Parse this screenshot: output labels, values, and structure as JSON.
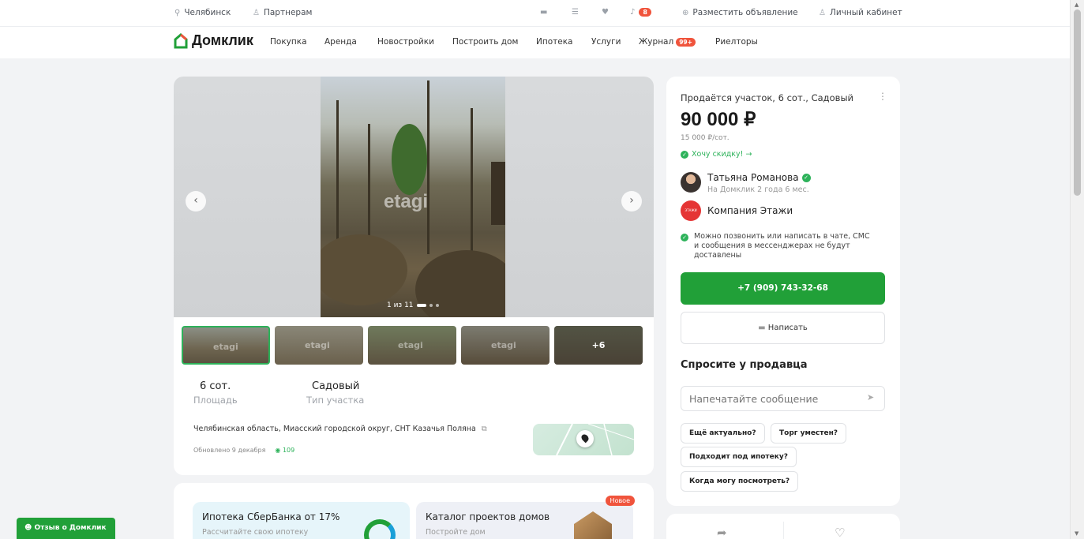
{
  "topbar": {
    "city": "Челябинск",
    "partners": "Партнерам",
    "notifications_count": "8",
    "post_ad": "Разместить объявление",
    "account": "Личный кабинет"
  },
  "nav": {
    "logo": "Домклик",
    "items": [
      "Покупка",
      "Аренда",
      "Новостройки",
      "Построить дом",
      "Ипотека",
      "Услуги",
      "Журнал",
      "Риелторы"
    ],
    "journal_badge": "99+"
  },
  "gallery": {
    "watermark": "etagi",
    "counter": "1 из 11",
    "thumbs_more": "+6"
  },
  "params": {
    "area_value": "6 сот.",
    "area_label": "Площадь",
    "type_value": "Садовый",
    "type_label": "Тип участка"
  },
  "address": "Челябинская область, Миасский городской округ, СНТ Казачья Поляна",
  "updated": "Обновлено 9 декабря",
  "views": "109",
  "promo": {
    "mortgage_title": "Ипотека СберБанка от 17%",
    "mortgage_sub": "Рассчитайте свою ипотеку",
    "catalog_title": "Каталог проектов домов",
    "catalog_sub": "Постройте дом",
    "new_badge": "Новое"
  },
  "listing": {
    "title": "Продаётся участок, 6 сот., Садовый",
    "price": "90 000 ₽",
    "price_per_unit": "15 000 ₽/сот.",
    "discount": "Хочу скидку! →",
    "agent_name": "Татьяна Романова",
    "agent_sub": "На Домклик 2 года 6 мес.",
    "company": "Компания Этажи",
    "company_logo_text": "ЭТАЖИ",
    "notice": "Можно позвонить или написать в чате, СМС и сообщения в мессенджерах не будут доставлены",
    "phone": "+7 (909) 743-32-68",
    "write": "Написать",
    "ask_title": "Спросите у продавца",
    "message_placeholder": "Напечатайте сообщение",
    "chips": [
      "Ещё актуально?",
      "Торг уместен?",
      "Подходит под ипотеку?",
      "Когда могу посмотреть?"
    ]
  },
  "feedback": "Отзыв о Домклик",
  "colors": {
    "brand_green": "#21a038",
    "accent_red": "#f0543c",
    "background": "#f2f3f5"
  }
}
